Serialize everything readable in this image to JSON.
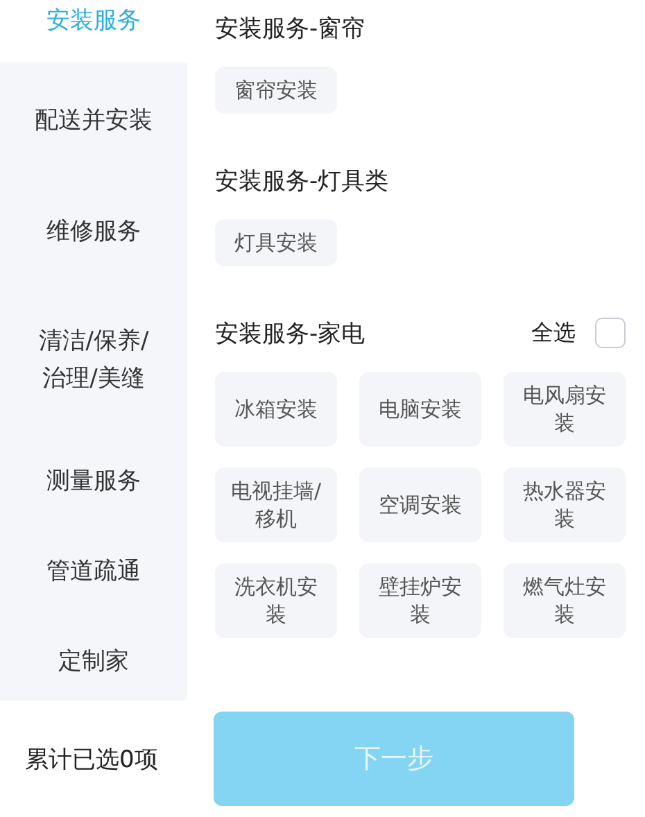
{
  "sidebar": {
    "items": [
      {
        "label": "安装服务",
        "selected": true
      },
      {
        "label": "配送并安装",
        "selected": false
      },
      {
        "label": "维修服务",
        "selected": false
      },
      {
        "label": "清洁/保养/治理/美缝",
        "selected": false
      },
      {
        "label": "测量服务",
        "selected": false
      },
      {
        "label": "管道疏通",
        "selected": false
      },
      {
        "label": "定制家",
        "selected": false
      }
    ]
  },
  "sections": [
    {
      "title": "安装服务-窗帘",
      "options": [
        "窗帘安装"
      ]
    },
    {
      "title": "安装服务-灯具类",
      "options": [
        "灯具安装"
      ]
    },
    {
      "title": "安装服务-家电",
      "select_all": {
        "label": "全选",
        "checked": false
      },
      "options": [
        "冰箱安装",
        "电脑安装",
        "电风扇安装",
        "电视挂墙/移机",
        "空调安装",
        "热水器安装",
        "洗衣机安装",
        "壁挂炉安装",
        "燃气灶安装"
      ]
    }
  ],
  "footer": {
    "summary": "累计已选0项",
    "next_button": {
      "label": "下一步",
      "disabled": true
    }
  }
}
